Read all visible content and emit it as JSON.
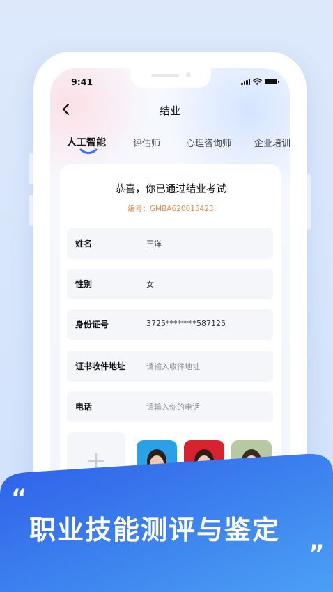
{
  "status_bar": {
    "time": "9:41"
  },
  "nav": {
    "title": "结业"
  },
  "tabs": [
    {
      "label": "人工智能",
      "active": true
    },
    {
      "label": "评估师",
      "active": false
    },
    {
      "label": "心理咨询师",
      "active": false
    },
    {
      "label": "企业培训",
      "active": false
    }
  ],
  "card": {
    "title": "恭喜，你已通过结业考试",
    "number": "编号：GMBA620015423",
    "fields": [
      {
        "label": "姓名",
        "value": "王洋",
        "placeholder": false
      },
      {
        "label": "性别",
        "value": "女",
        "placeholder": false
      },
      {
        "label": "身份证号",
        "value": "3725********587125",
        "placeholder": false
      },
      {
        "label": "证书收件地址",
        "value": "请输入收件地址",
        "placeholder": true
      },
      {
        "label": "电话",
        "value": "请输入你的电话",
        "placeholder": true
      }
    ]
  },
  "banner": {
    "quote_open": "“",
    "slogan": "职业技能测评与鉴定",
    "quote_close": "„"
  },
  "colors": {
    "accent": "#3a6cf5",
    "number_text": "#e38c48",
    "banner_start": "#2e5fe8",
    "banner_end": "#4aa0f4"
  },
  "icons": [
    "back-icon",
    "signal-icon",
    "wifi-icon",
    "battery-icon",
    "plus-icon"
  ]
}
